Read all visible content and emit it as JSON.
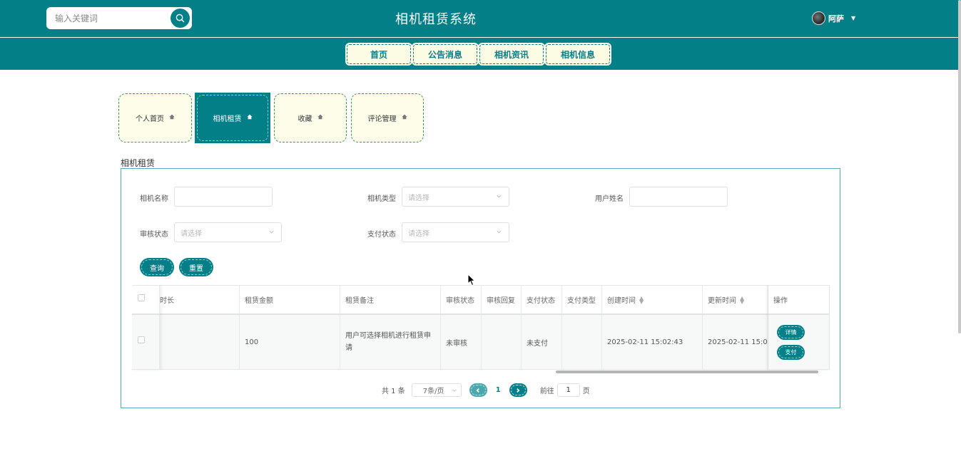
{
  "header": {
    "search_placeholder": "输入关键词",
    "title": "相机租赁系统",
    "username": "阿萨"
  },
  "nav": {
    "items": [
      "首页",
      "公告消息",
      "相机资讯",
      "相机信息"
    ]
  },
  "side_tabs": {
    "items": [
      {
        "label": "个人首页",
        "active": false
      },
      {
        "label": "相机租赁",
        "active": true
      },
      {
        "label": "收藏",
        "active": false
      },
      {
        "label": "评论管理",
        "active": false
      }
    ]
  },
  "section_title": "相机租赁",
  "filters": {
    "camera_name_label": "相机名称",
    "camera_type_label": "相机类型",
    "camera_type_placeholder": "请选择",
    "user_name_label": "用户姓名",
    "review_status_label": "审核状态",
    "review_status_placeholder": "请选择",
    "pay_status_label": "支付状态",
    "pay_status_placeholder": "请选择",
    "query_button": "查询",
    "reset_button": "重置"
  },
  "table": {
    "columns": {
      "duration": "时长",
      "amount": "租赁金额",
      "remark": "租赁备注",
      "review_status": "审核状态",
      "review_reply": "审核回复",
      "pay_status": "支付状态",
      "pay_type": "支付类型",
      "created": "创建时间",
      "updated": "更新时间",
      "actions": "操作"
    },
    "rows": [
      {
        "duration": "",
        "amount": "100",
        "remark": "用户可选择相机进行租赁申请",
        "review_status": "未审核",
        "review_reply": "",
        "pay_status": "未支付",
        "pay_type": "",
        "created": "2025-02-11 15:02:43",
        "updated": "2025-02-11 15:02:43",
        "detail_button": "详情",
        "pay_button": "支付"
      }
    ]
  },
  "pagination": {
    "total_text": "共 1 条",
    "page_size": "7条/页",
    "current_page": "1",
    "goto_label": "前往",
    "goto_value": "1",
    "page_unit": "页"
  },
  "colors": {
    "primary": "#037f87",
    "tab_bg": "#fdfde9",
    "nav_item_bg": "#fcfbe4"
  }
}
